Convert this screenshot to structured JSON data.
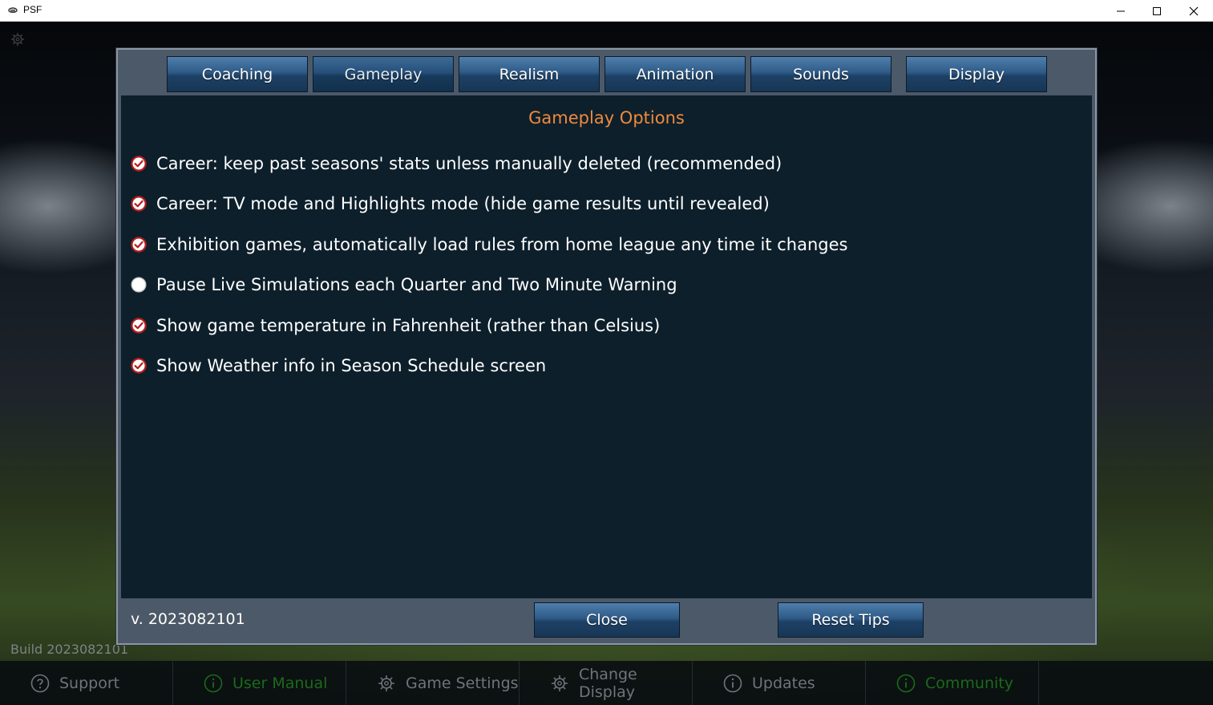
{
  "window": {
    "title": "PSF",
    "controls": [
      "minimize",
      "maximize",
      "close"
    ]
  },
  "dialog": {
    "tabs": [
      {
        "label": "Coaching"
      },
      {
        "label": "Gameplay",
        "active": true
      },
      {
        "label": "Realism"
      },
      {
        "label": "Animation"
      },
      {
        "label": "Sounds"
      },
      {
        "label": "Display"
      }
    ],
    "section_title": "Gameplay Options",
    "options": [
      {
        "label": "Career: keep past seasons' stats unless manually deleted (recommended)",
        "checked": true
      },
      {
        "label": "Career: TV mode and Highlights mode (hide game results until revealed)",
        "checked": true
      },
      {
        "label": "Exhibition games, automatically load rules from home league any time it changes",
        "checked": true
      },
      {
        "label": "Pause Live Simulations each Quarter and Two Minute Warning",
        "checked": false
      },
      {
        "label": "Show game temperature in Fahrenheit (rather than Celsius)",
        "checked": true
      },
      {
        "label": "Show Weather info in Season Schedule screen",
        "checked": true
      }
    ],
    "version": "v. 2023082101",
    "close_label": "Close",
    "reset_tips_label": "Reset Tips"
  },
  "background": {
    "build": "Build 2023082101",
    "menu": [
      {
        "label": "Support",
        "icon": "question-icon"
      },
      {
        "label": "User Manual",
        "icon": "info-icon"
      },
      {
        "label": "Game Settings",
        "icon": "gear-icon"
      },
      {
        "label": "Change Display",
        "icon": "gear-icon"
      },
      {
        "label": "Updates",
        "icon": "info-icon"
      },
      {
        "label": "Community",
        "icon": "info-icon"
      }
    ]
  },
  "colors": {
    "accent_title": "#f08a3c",
    "check_red": "#b71c1c",
    "content_bg": "#0d1f2b",
    "tab_blue": "#2e5a86"
  }
}
